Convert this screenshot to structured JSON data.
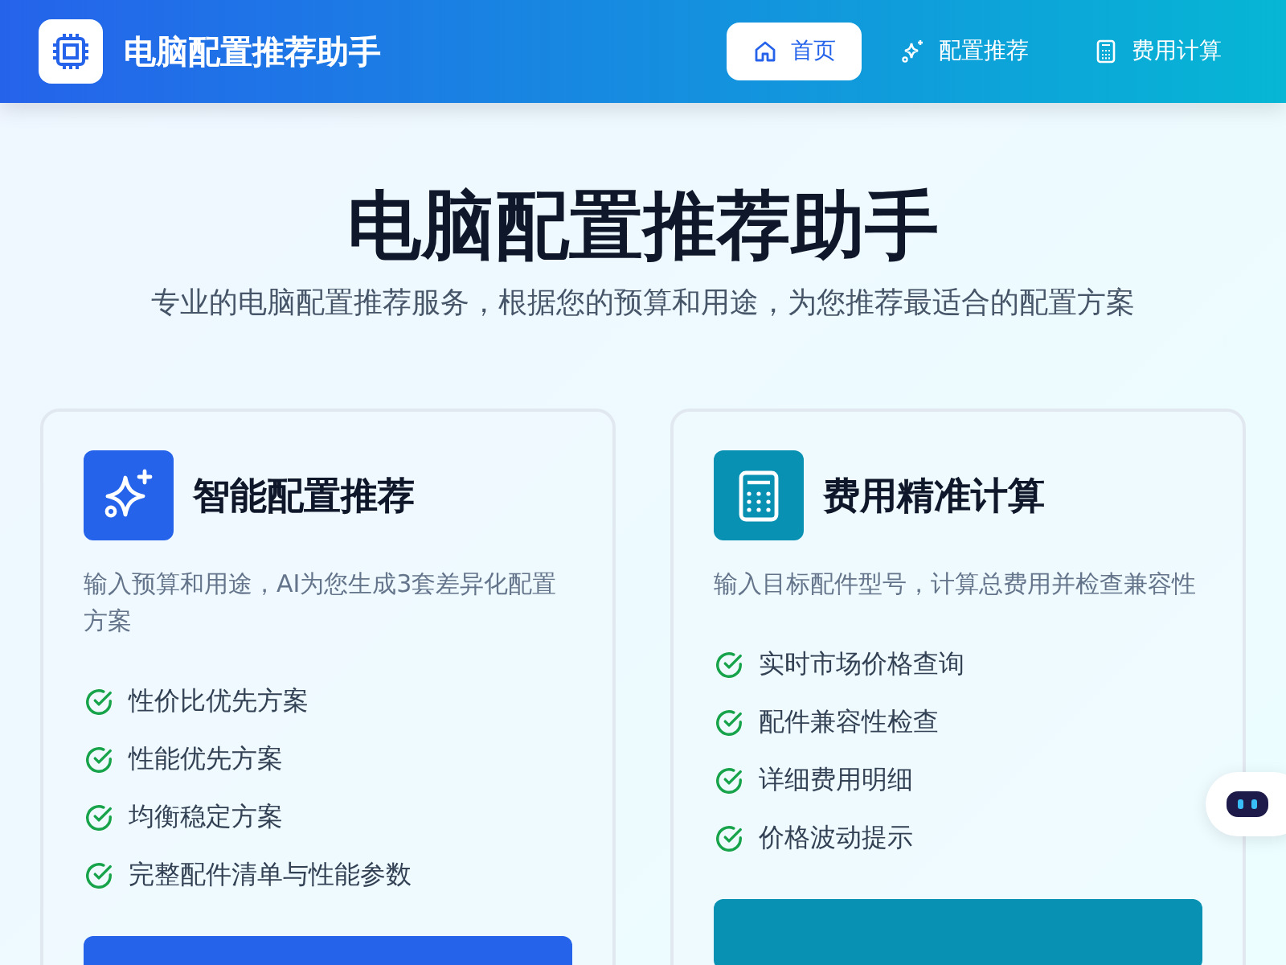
{
  "header": {
    "title": "电脑配置推荐助手",
    "nav": [
      {
        "label": "首页",
        "kind": "home",
        "selected": true
      },
      {
        "label": "配置推荐",
        "kind": "sparkle",
        "selected": false
      },
      {
        "label": "费用计算",
        "kind": "calculator",
        "selected": false
      }
    ]
  },
  "hero": {
    "title": "电脑配置推荐助手",
    "subtitle": "专业的电脑配置推荐服务，根据您的预算和用途，为您推荐最适合的配置方案"
  },
  "cards": [
    {
      "kind": "sparkle",
      "title": "智能配置推荐",
      "description": "输入预算和用途，AI为您生成3套差异化配置方案",
      "features": [
        "性价比优先方案",
        "性能优先方案",
        "均衡稳定方案",
        "完整配件清单与性能参数"
      ]
    },
    {
      "kind": "calculator",
      "title": "费用精准计算",
      "description": "输入目标配件型号，计算总费用并检查兼容性",
      "features": [
        "实时市场价格查询",
        "配件兼容性检查",
        "详细费用明细",
        "价格波动提示"
      ]
    }
  ]
}
